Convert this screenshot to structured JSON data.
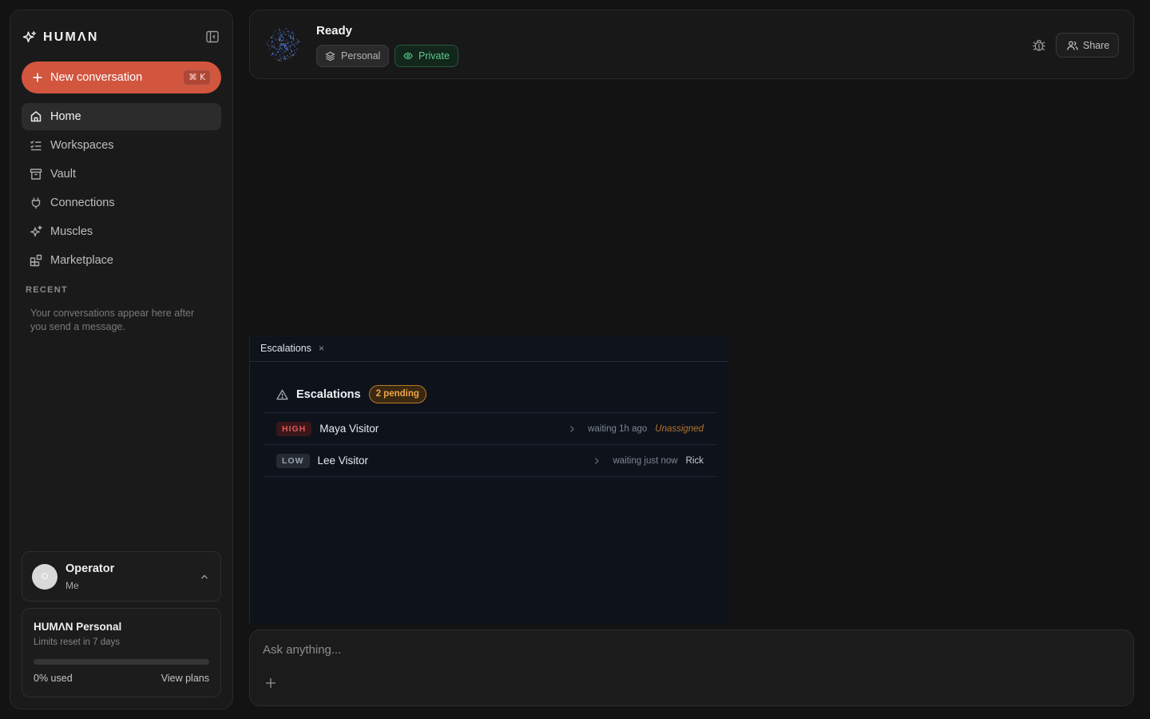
{
  "sidebar": {
    "brand": "HUMΛN",
    "new_conversation": {
      "label": "New conversation",
      "shortcut": "⌘ K"
    },
    "nav": [
      {
        "label": "Home",
        "icon": "home-icon",
        "active": true
      },
      {
        "label": "Workspaces",
        "icon": "list-checks-icon",
        "active": false
      },
      {
        "label": "Vault",
        "icon": "archive-icon",
        "active": false
      },
      {
        "label": "Connections",
        "icon": "plug-icon",
        "active": false
      },
      {
        "label": "Muscles",
        "icon": "sparkles-icon",
        "active": false
      },
      {
        "label": "Marketplace",
        "icon": "blocks-icon",
        "active": false
      }
    ],
    "recent_heading": "RECENT",
    "recent_empty": "Your conversations appear here after you send a message.",
    "user": {
      "initial": "O",
      "name": "Operator",
      "subtitle": "Me"
    },
    "plan": {
      "title": "HUMΛN Personal",
      "subtitle": "Limits reset in 7 days",
      "used_fraction": 0,
      "used_label": "0% used",
      "view_plans": "View plans"
    }
  },
  "header": {
    "status": "Ready",
    "tags": {
      "personal": "Personal",
      "private": "Private"
    },
    "share": "Share"
  },
  "escalations_panel": {
    "tab_label": "Escalations",
    "tab_close": "×",
    "title": "Escalations",
    "pending_badge": "2 pending",
    "rows": [
      {
        "severity": "HIGH",
        "name": "Maya Visitor",
        "waiting": "waiting 1h ago",
        "assignee": "Unassigned"
      },
      {
        "severity": "LOW",
        "name": "Lee Visitor",
        "waiting": "waiting just now",
        "assignee": "Rick"
      }
    ]
  },
  "composer": {
    "placeholder": "Ask anything..."
  },
  "colors": {
    "accent": "#d2553e",
    "private_green": "#5fc98a",
    "pending_orange": "#f0a548",
    "high_red": "#e0575d"
  }
}
